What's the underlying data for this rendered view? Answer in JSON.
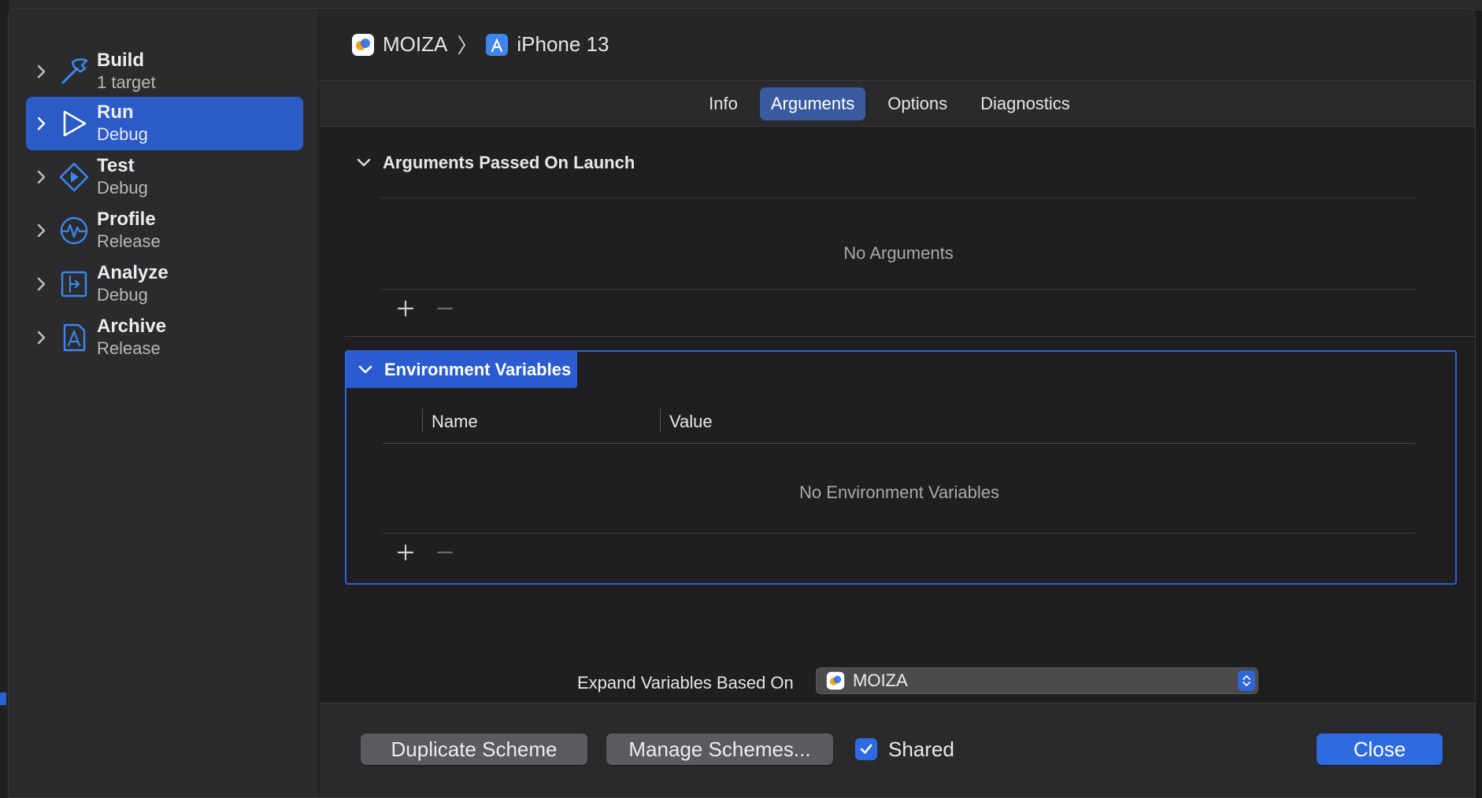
{
  "sidebar": {
    "items": [
      {
        "title": "Build",
        "subtitle": "1 target",
        "icon": "hammer-icon"
      },
      {
        "title": "Run",
        "subtitle": "Debug",
        "icon": "play-icon"
      },
      {
        "title": "Test",
        "subtitle": "Debug",
        "icon": "test-diamond-icon"
      },
      {
        "title": "Profile",
        "subtitle": "Release",
        "icon": "profile-waveform-icon"
      },
      {
        "title": "Analyze",
        "subtitle": "Debug",
        "icon": "analyze-icon"
      },
      {
        "title": "Archive",
        "subtitle": "Release",
        "icon": "archive-icon"
      }
    ],
    "selected_index": 1
  },
  "breadcrumb": {
    "scheme": "MOIZA",
    "separator": "〉",
    "destination": "iPhone 13"
  },
  "tabs": [
    "Info",
    "Arguments",
    "Options",
    "Diagnostics"
  ],
  "active_tab": "Arguments",
  "arguments_section": {
    "title": "Arguments Passed On Launch",
    "empty": "No Arguments",
    "add": "+",
    "remove": "—"
  },
  "env_section": {
    "title": "Environment Variables",
    "col_name": "Name",
    "col_value": "Value",
    "empty": "No Environment Variables",
    "add": "+",
    "remove": "—"
  },
  "expand": {
    "label": "Expand Variables Based On",
    "value": "MOIZA"
  },
  "footer": {
    "duplicate": "Duplicate Scheme",
    "manage": "Manage Schemes...",
    "shared_label": "Shared",
    "shared_checked": true,
    "close": "Close"
  },
  "colors": {
    "accent": "#2f6be0",
    "selection": "#2a5bc7"
  }
}
